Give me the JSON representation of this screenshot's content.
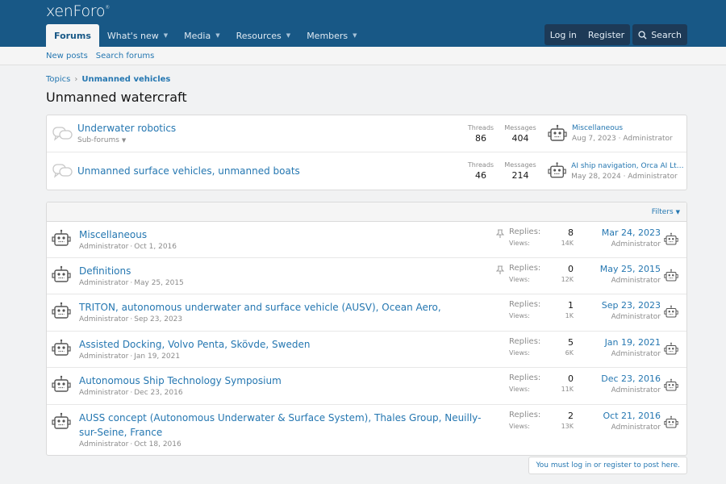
{
  "brand": {
    "logo_main": "xenForo",
    "logo_mark": "®"
  },
  "nav": {
    "tabs": [
      {
        "label": "Forums",
        "active": true
      },
      {
        "label": "What's new",
        "active": false
      },
      {
        "label": "Media",
        "active": false
      },
      {
        "label": "Resources",
        "active": false
      },
      {
        "label": "Members",
        "active": false
      }
    ],
    "login": "Log in",
    "register": "Register",
    "search": "Search"
  },
  "subnav": {
    "new_posts": "New posts",
    "search_forums": "Search forums"
  },
  "breadcrumb": {
    "items": [
      "Topics",
      "Unmanned vehicles"
    ]
  },
  "page_title": "Unmanned watercraft",
  "nodes": [
    {
      "title": "Underwater robotics",
      "subtitle": "Sub-forums",
      "threads_label": "Threads",
      "threads": "86",
      "messages_label": "Messages",
      "messages": "404",
      "latest_title": "Miscellaneous",
      "latest_date": "Aug 7, 2023",
      "latest_user": "Administrator"
    },
    {
      "title": "Unmanned surface vehicles, unmanned boats",
      "subtitle": "",
      "threads_label": "Threads",
      "threads": "46",
      "messages_label": "Messages",
      "messages": "214",
      "latest_title": "AI ship navigation, Orca AI Ltd., Tel ...",
      "latest_date": "May 28, 2024",
      "latest_user": "Administrator"
    }
  ],
  "filters_label": "Filters",
  "threads": [
    {
      "title": "Miscellaneous",
      "author": "Administrator",
      "started": "Oct 1, 2016",
      "pinned": true,
      "replies_label": "Replies:",
      "replies": "8",
      "views_label": "Views:",
      "views": "14K",
      "last_date": "Mar 24, 2023",
      "last_user": "Administrator"
    },
    {
      "title": "Definitions",
      "author": "Administrator",
      "started": "May 25, 2015",
      "pinned": true,
      "replies_label": "Replies:",
      "replies": "0",
      "views_label": "Views:",
      "views": "12K",
      "last_date": "May 25, 2015",
      "last_user": "Administrator"
    },
    {
      "title": "TRITON, autonomous underwater and surface vehicle (AUSV), Ocean Aero,",
      "author": "Administrator",
      "started": "Sep 23, 2023",
      "pinned": false,
      "replies_label": "Replies:",
      "replies": "1",
      "views_label": "Views:",
      "views": "1K",
      "last_date": "Sep 23, 2023",
      "last_user": "Administrator"
    },
    {
      "title": "Assisted Docking, Volvo Penta, Skövde, Sweden",
      "author": "Administrator",
      "started": "Jan 19, 2021",
      "pinned": false,
      "replies_label": "Replies:",
      "replies": "5",
      "views_label": "Views:",
      "views": "6K",
      "last_date": "Jan 19, 2021",
      "last_user": "Administrator"
    },
    {
      "title": "Autonomous Ship Technology Symposium",
      "author": "Administrator",
      "started": "Dec 23, 2016",
      "pinned": false,
      "replies_label": "Replies:",
      "replies": "0",
      "views_label": "Views:",
      "views": "11K",
      "last_date": "Dec 23, 2016",
      "last_user": "Administrator"
    },
    {
      "title": "AUSS concept (Autonomous Underwater & Surface System), Thales Group, Neuilly-sur-Seine, France",
      "author": "Administrator",
      "started": "Oct 18, 2016",
      "pinned": false,
      "replies_label": "Replies:",
      "replies": "2",
      "views_label": "Views:",
      "views": "13K",
      "last_date": "Oct 21, 2016",
      "last_user": "Administrator"
    }
  ],
  "login_note": "You must log in or register to post here.",
  "colors": {
    "header": "#185886",
    "link": "#2577b1",
    "page_bg": "#f1f2f3"
  }
}
